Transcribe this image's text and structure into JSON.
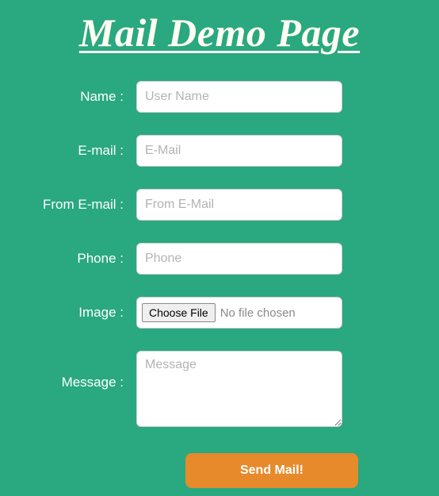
{
  "title": "Mail Demo Page",
  "form": {
    "name": {
      "label": "Name :",
      "placeholder": "User Name",
      "value": ""
    },
    "email": {
      "label": "E-mail :",
      "placeholder": "E-Mail",
      "value": ""
    },
    "from_email": {
      "label": "From E-mail :",
      "placeholder": "From E-Mail",
      "value": ""
    },
    "phone": {
      "label": "Phone :",
      "placeholder": "Phone",
      "value": ""
    },
    "image": {
      "label": "Image :",
      "button": "Choose File",
      "status": "No file chosen"
    },
    "message": {
      "label": "Message :",
      "placeholder": "Message",
      "value": ""
    },
    "submit": "Send Mail!"
  }
}
